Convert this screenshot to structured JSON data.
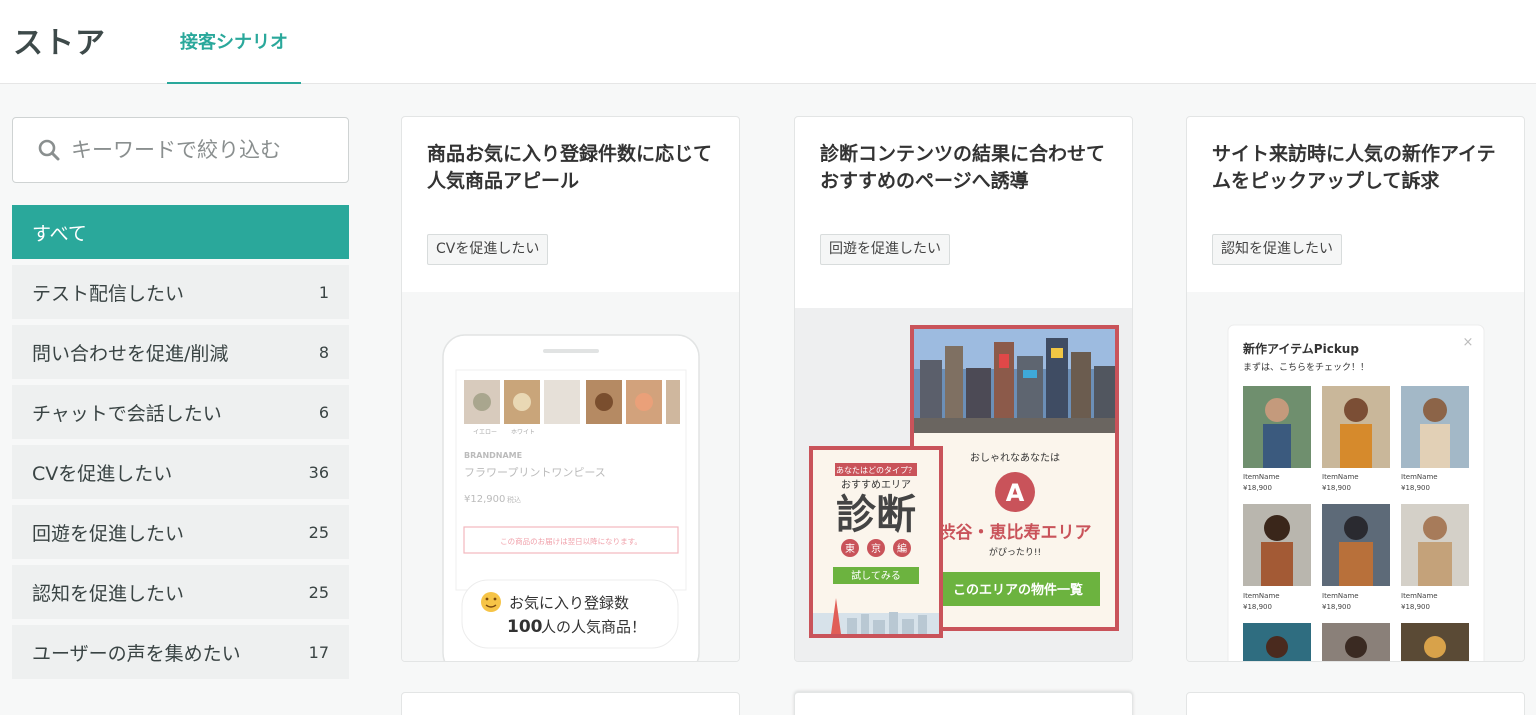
{
  "header": {
    "store_title": "ストア",
    "tab_label": "接客シナリオ"
  },
  "search": {
    "placeholder": "キーワードで絞り込む"
  },
  "categories": [
    {
      "label": "すべて",
      "count": ""
    },
    {
      "label": "テスト配信したい",
      "count": "1"
    },
    {
      "label": "問い合わせを促進/削減",
      "count": "8"
    },
    {
      "label": "チャットで会話したい",
      "count": "6"
    },
    {
      "label": "CVを促進したい",
      "count": "36"
    },
    {
      "label": "回遊を促進したい",
      "count": "25"
    },
    {
      "label": "認知を促進したい",
      "count": "25"
    },
    {
      "label": "ユーザーの声を集めたい",
      "count": "17"
    }
  ],
  "cards": [
    {
      "title": "商品お気に入り登録件数に応じて人気商品アピール",
      "tag": "CVを促進したい",
      "preview": {
        "color_labels": [
          "イエロー",
          "ホワイト"
        ],
        "brand": "BRANDNAME",
        "product": "フラワープリントワンピース",
        "price": "¥12,900",
        "price_note": "税込",
        "notice": "この商品のお届けは翌日以降になります。",
        "popup_line1": "お気に入り登録数",
        "popup_count": "100",
        "popup_line2": "人の人気商品！"
      }
    },
    {
      "title": "診断コンテンツの結果に合わせておすすめのページへ誘導",
      "tag": "回遊を促進したい",
      "preview": {
        "small_banner": "あなたはどのタイプ？",
        "small_sub": "おすすめエリア",
        "big_word": "診断",
        "chars": [
          "東",
          "京",
          "編"
        ],
        "try_button": "試してみる",
        "result_intro": "おしゃれなあなたは",
        "result_letter": "A",
        "result_area": "渋谷・恵比寿エリア",
        "result_fit": "がぴったり!!",
        "result_button": "このエリアの物件一覧"
      }
    },
    {
      "title": "サイト来訪時に人気の新作アイテムをピックアップして訴求",
      "tag": "認知を促進したい",
      "preview": {
        "popup_title": "新作アイテムPickup",
        "popup_sub": "まずは、こちらをチェック！！",
        "close": "×",
        "item_name": "ItemName",
        "item_price": "¥18,900"
      }
    }
  ],
  "colors": {
    "accent": "#2aa89b",
    "diagnosis_red": "#c9535a",
    "diagnosis_green": "#6cb33f"
  }
}
